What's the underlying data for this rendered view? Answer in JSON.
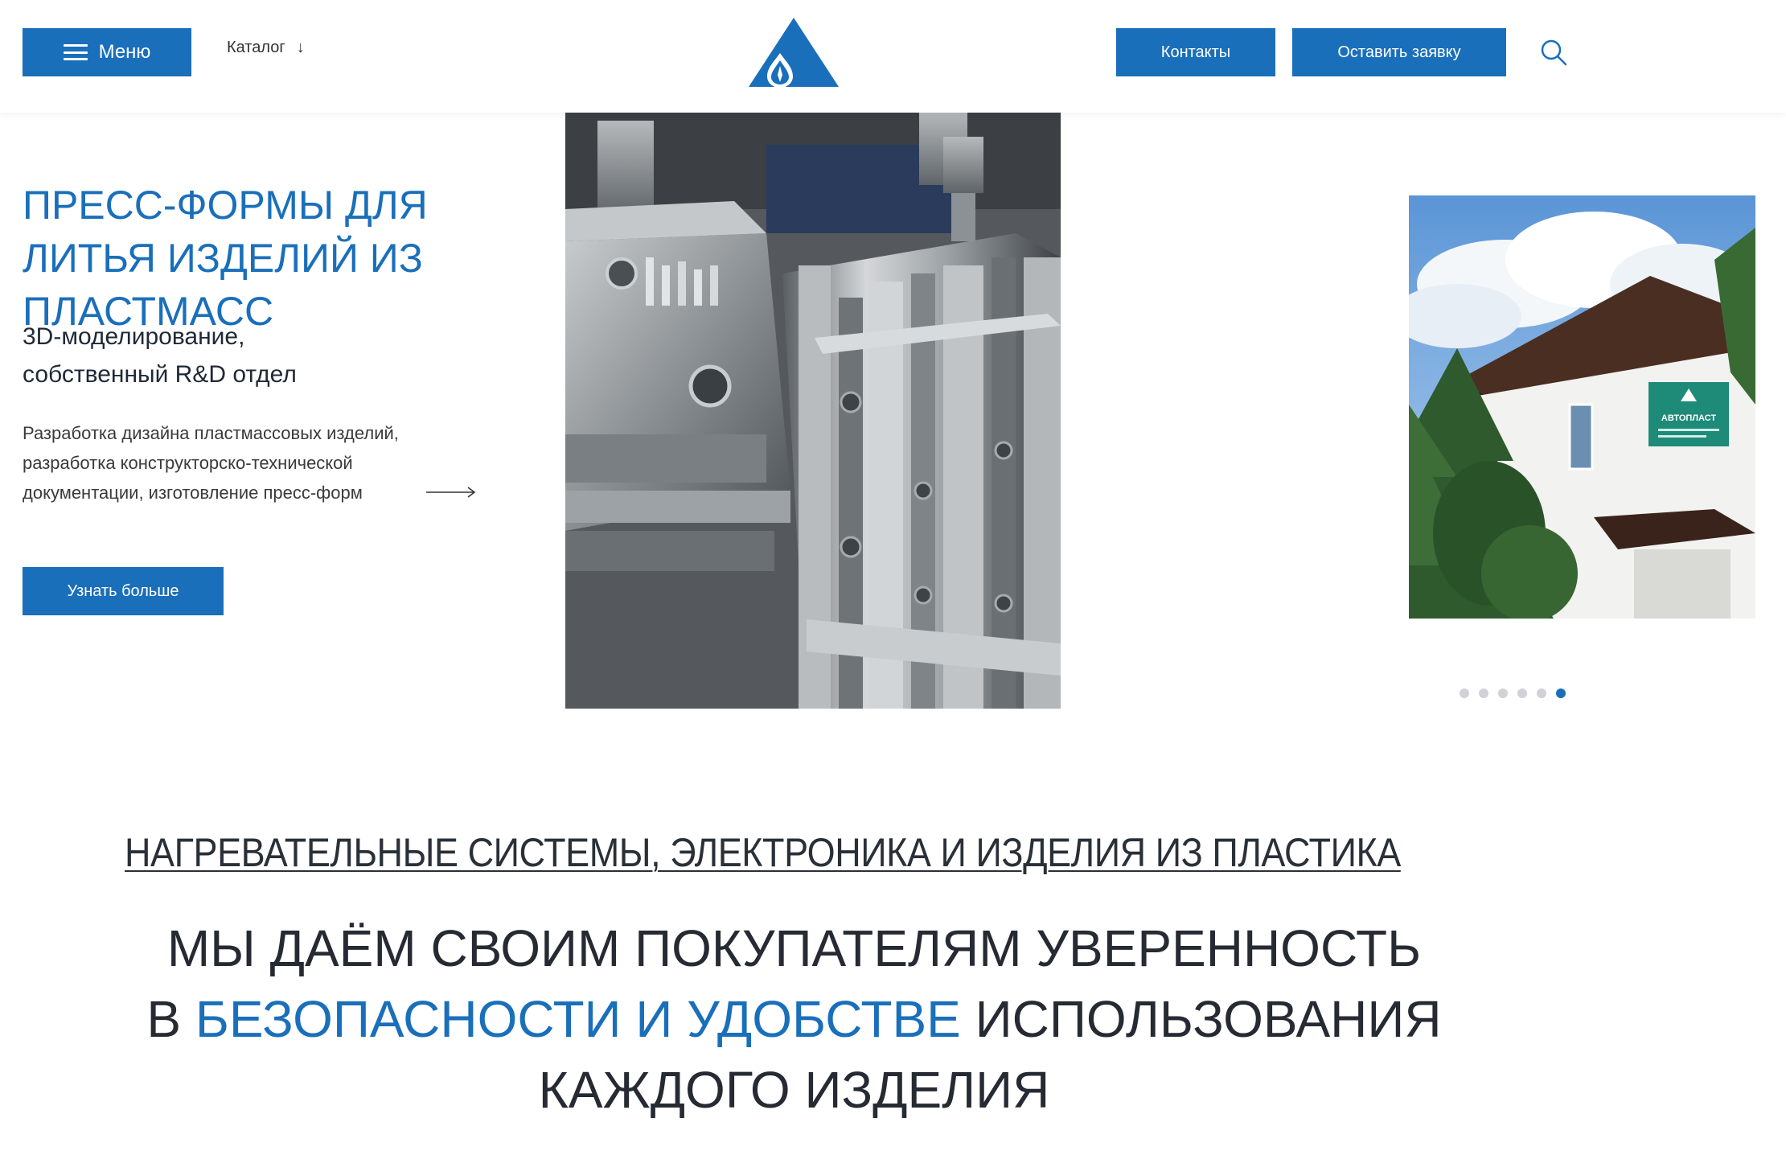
{
  "header": {
    "menu_label": "Меню",
    "catalog_label": "Каталог",
    "contacts_label": "Контакты",
    "request_label": "Оставить заявку"
  },
  "hero": {
    "title": "ПРЕСС-ФОРМЫ ДЛЯ ЛИТЬЯ ИЗДЕЛИЙ ИЗ ПЛАСТМАСС",
    "subtitle_line1": "3D-моделирование,",
    "subtitle_line2": "собственный R&D отдел",
    "desc_line1": "Разработка дизайна пластмассовых изделий,",
    "desc_line2": "разработка конструкторско-технической",
    "desc_line3": "документации, изготовление пресс-форм",
    "more_label": "Узнать больше",
    "sign_text": "АВТОПЛАСТ"
  },
  "slider": {
    "total": 6,
    "active_index": 5
  },
  "section": {
    "link_text": "НАГРЕВАТЕЛЬНЫЕ СИСТЕМЫ, ЭЛЕКТРОНИКА И ИЗДЕЛИЯ ИЗ ПЛАСТИКА",
    "tagline_line1": "МЫ ДАЁМ СВОИМ ПОКУПАТЕЛЯМ УВЕРЕННОСТЬ",
    "tagline_line2_prefix": "В ",
    "tagline_line2_accent": "БЕЗОПАСНОСТИ И УДОБСТВЕ",
    "tagline_line2_suffix": " ИСПОЛЬЗОВАНИЯ",
    "tagline_line3": "КАЖДОГО ИЗДЕЛИЯ"
  },
  "colors": {
    "brand": "#1a6fba",
    "text_dark": "#252a33",
    "dot_inactive": "#cfd3d8"
  },
  "icons": {
    "menu": "burger-icon",
    "catalog": "arrow-down-icon",
    "search": "search-icon",
    "hero_link": "long-arrow-right-icon",
    "logo": "triangle-drop-logo"
  }
}
